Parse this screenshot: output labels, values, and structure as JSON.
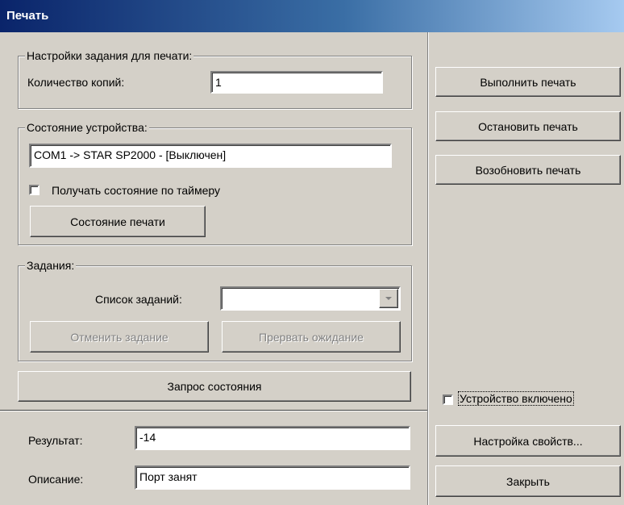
{
  "window": {
    "title": "Печать"
  },
  "job_settings": {
    "legend": "Настройки задания для печати:",
    "copies_label": "Количество копий:",
    "copies_value": "1"
  },
  "device_state": {
    "legend": "Состояние устройства:",
    "status_value": "COM1 -> STAR SP2000 - [Выключен]",
    "timer_checkbox_label": "Получать состояние по таймеру",
    "timer_checked": false,
    "print_state_button": "Состояние печати"
  },
  "jobs": {
    "legend": "Задания:",
    "list_label": "Список заданий:",
    "list_value": "",
    "cancel_button": "Отменить задание",
    "abort_wait_button": "Прервать ожидание"
  },
  "query_button": "Запрос состояния",
  "result": {
    "result_label": "Результат:",
    "result_value": "-14",
    "description_label": "Описание:",
    "description_value": "Порт занят"
  },
  "right_panel": {
    "execute_button": "Выполнить печать",
    "stop_button": "Остановить печать",
    "resume_button": "Возобновить печать",
    "device_enabled_label": "Устройство включено",
    "device_enabled_checked": false,
    "properties_button": "Настройка свойств...",
    "close_button": "Закрыть"
  }
}
